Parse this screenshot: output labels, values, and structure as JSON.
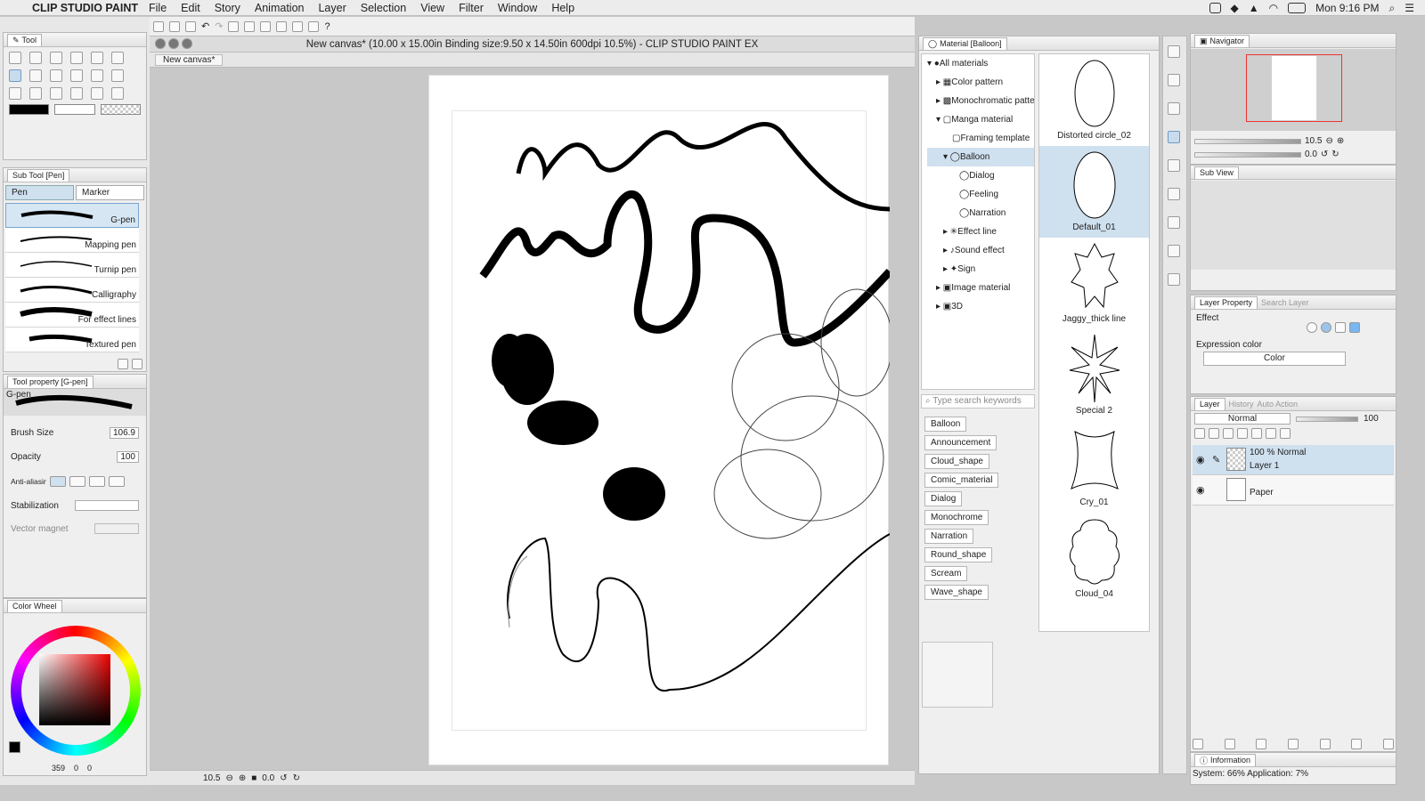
{
  "menubar": {
    "app_name": "CLIP STUDIO PAINT",
    "items": [
      "File",
      "Edit",
      "Story",
      "Animation",
      "Layer",
      "Selection",
      "View",
      "Filter",
      "Window",
      "Help"
    ],
    "clock": "Mon 9:16 PM"
  },
  "window_title": "New canvas* (10.00 x 15.00in Binding size:9.50 x 14.50in 600dpi 10.5%)  - CLIP STUDIO PAINT EX",
  "doc_tab": "New canvas*",
  "tool_panel": {
    "title": "Tool"
  },
  "subtool_panel": {
    "title": "Sub Tool [Pen]",
    "tabs": [
      "Pen",
      "Marker"
    ],
    "brushes": [
      "G-pen",
      "Mapping pen",
      "Turnip pen",
      "Calligraphy",
      "For effect lines",
      "Textured pen"
    ]
  },
  "tool_property": {
    "title": "Tool property [G-pen]",
    "preview_name": "G-pen",
    "brush_size_label": "Brush Size",
    "brush_size_value": "106.9",
    "opacity_label": "Opacity",
    "opacity_value": "100",
    "antialias_label": "Anti-aliasing",
    "stabilization_label": "Stabilization",
    "vector_magnet_label": "Vector magnet"
  },
  "color_panel": {
    "title": "Color Wheel",
    "footer": "359",
    "footer_b": "0",
    "footer_c": "0"
  },
  "status": {
    "zoom": "10.5",
    "angle": "0.0"
  },
  "material_panel": {
    "title": "Material [Balloon]",
    "tree": [
      {
        "label": "All materials",
        "level": 0
      },
      {
        "label": "Color pattern",
        "level": 1
      },
      {
        "label": "Monochromatic pattern",
        "level": 1
      },
      {
        "label": "Manga material",
        "level": 1
      },
      {
        "label": "Framing template",
        "level": 2
      },
      {
        "label": "Balloon",
        "level": 2
      },
      {
        "label": "Dialog",
        "level": 3
      },
      {
        "label": "Feeling",
        "level": 3
      },
      {
        "label": "Narration",
        "level": 3
      },
      {
        "label": "Effect line",
        "level": 2
      },
      {
        "label": "Sound effect",
        "level": 2
      },
      {
        "label": "Sign",
        "level": 2
      },
      {
        "label": "Image material",
        "level": 1
      },
      {
        "label": "3D",
        "level": 1
      }
    ],
    "search_placeholder": "Type search keywords",
    "tags": [
      "Balloon",
      "Announcement",
      "Cloud_shape",
      "Comic_material",
      "Dialog",
      "Monochrome",
      "Narration",
      "Round_shape",
      "Scream",
      "Wave_shape"
    ],
    "thumbs": [
      "Distorted circle_02",
      "Default_01",
      "Jaggy_thick line",
      "Special 2",
      "Cry_01",
      "Cloud_04"
    ]
  },
  "navigator": {
    "title": "Navigator",
    "zoom": "10.5",
    "angle": "0.0"
  },
  "subview": {
    "title": "Sub View"
  },
  "layer_property": {
    "title": "Layer Property",
    "tab2": "Search Layer",
    "effect_label": "Effect",
    "expression_label": "Expression color",
    "expression_value": "Color"
  },
  "layer_panel": {
    "title": "Layer",
    "tab2": "History",
    "tab3": "Auto Action",
    "blend_mode": "Normal",
    "opacity": "100",
    "layers": [
      {
        "mode": "100 % Normal",
        "name": "Layer 1"
      },
      {
        "mode": "",
        "name": "Paper"
      }
    ]
  },
  "info_panel": {
    "title": "Information",
    "text": "System: 66% Application: 7%"
  }
}
